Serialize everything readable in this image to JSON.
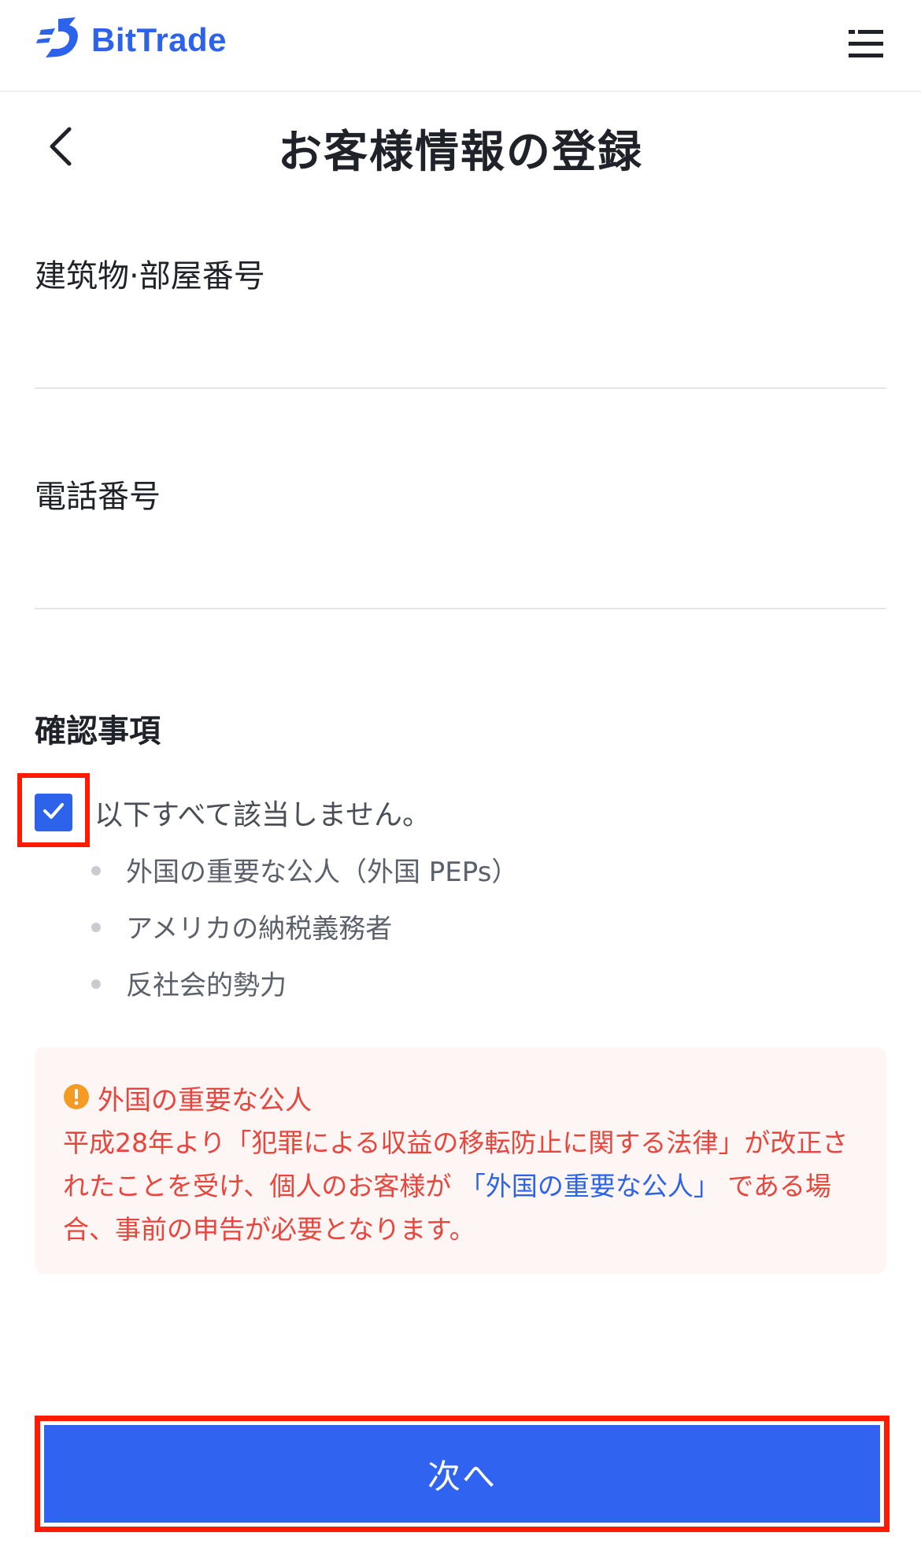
{
  "header": {
    "brand": "BitTrade",
    "logo_icon": "bittrade-logo-icon",
    "menu_icon": "menu-icon"
  },
  "title_bar": {
    "back_icon": "chevron-left-icon",
    "title": "お客様情報の登録"
  },
  "form": {
    "building_label": "建筑物·部屋番号",
    "building_value": "",
    "phone_label": "電話番号",
    "phone_value": ""
  },
  "confirmation": {
    "section_title": "確認事項",
    "checkbox_checked": true,
    "checkbox_label": "以下すべて該当しません。",
    "items": [
      "外国の重要な公人（外国 PEPs）",
      "アメリカの納税義務者",
      "反社会的勢力"
    ]
  },
  "notice": {
    "icon": "warning-icon",
    "title": "外国の重要な公人",
    "body_before": "平成28年より「犯罪による収益の移転防止に関する法律」が改正されたことを受け、個人のお客様が ",
    "link_text": "「外国の重要な公人」",
    "body_after": " である場合、事前の申告が必要となります。"
  },
  "footer": {
    "next_label": "次へ"
  },
  "colors": {
    "brand_blue": "#2d63ea",
    "button_blue": "#3064f0",
    "warning_red": "#e8453c",
    "highlight_red": "#ff1a00",
    "notice_bg": "#fdf6f4"
  }
}
